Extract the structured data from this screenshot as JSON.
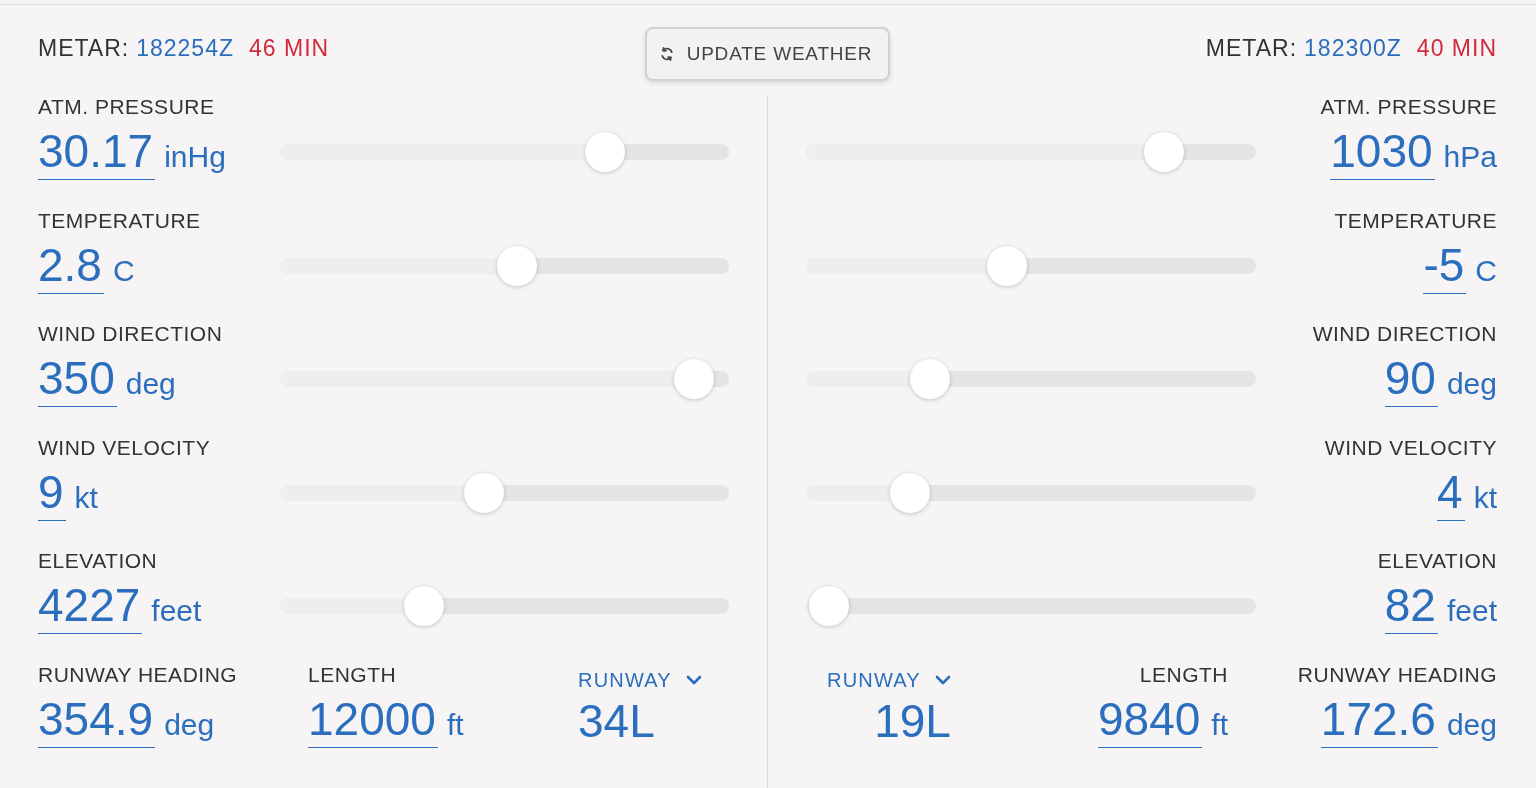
{
  "update_button": {
    "label": "UPDATE WEATHER"
  },
  "stations": [
    {
      "metar": {
        "label": "METAR:",
        "time": "182254Z",
        "age": "46 MIN"
      },
      "parameters": [
        {
          "label": "ATM. PRESSURE",
          "value": "30.17",
          "unit": "inHg",
          "level": 0.75
        },
        {
          "label": "TEMPERATURE",
          "value": "2.8",
          "unit": "C",
          "level": 0.53
        },
        {
          "label": "WIND DIRECTION",
          "value": "350",
          "unit": "deg",
          "level": 0.97
        },
        {
          "label": "WIND VELOCITY",
          "value": "9",
          "unit": "kt",
          "level": 0.45
        },
        {
          "label": "ELEVATION",
          "value": "4227",
          "unit": "feet",
          "level": 0.3
        }
      ],
      "runway_fields": [
        {
          "kind": "input",
          "label": "RUNWAY HEADING",
          "value": "354.9",
          "unit": "deg"
        },
        {
          "kind": "input",
          "label": "LENGTH",
          "value": "12000",
          "unit": "ft"
        },
        {
          "kind": "dropdown",
          "label": "RUNWAY",
          "value": "34L"
        }
      ]
    },
    {
      "metar": {
        "label": "METAR:",
        "time": "182300Z",
        "age": "40 MIN"
      },
      "parameters": [
        {
          "label": "ATM. PRESSURE",
          "value": "1030",
          "unit": "hPa",
          "level": 0.83
        },
        {
          "label": "TEMPERATURE",
          "value": "-5",
          "unit": "C",
          "level": 0.44
        },
        {
          "label": "WIND DIRECTION",
          "value": "90",
          "unit": "deg",
          "level": 0.25
        },
        {
          "label": "WIND VELOCITY",
          "value": "4",
          "unit": "kt",
          "level": 0.2
        },
        {
          "label": "ELEVATION",
          "value": "82",
          "unit": "feet",
          "level": 0
        }
      ],
      "runway_fields": [
        {
          "kind": "dropdown",
          "label": "RUNWAY",
          "value": "19L"
        },
        {
          "kind": "input",
          "label": "LENGTH",
          "value": "9840",
          "unit": "ft"
        },
        {
          "kind": "input",
          "label": "RUNWAY HEADING",
          "value": "172.6",
          "unit": "deg"
        }
      ]
    }
  ]
}
